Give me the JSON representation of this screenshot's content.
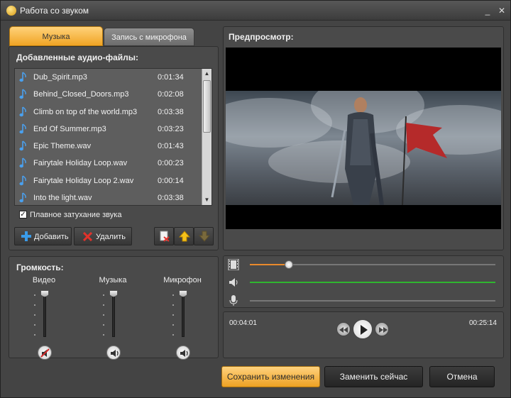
{
  "window": {
    "title": "Работа со звуком",
    "minimize_glyph": "_",
    "close_glyph": "✕"
  },
  "tabs": [
    {
      "label": "Музыка",
      "active": true
    },
    {
      "label": "Запись с микрофона",
      "active": false
    }
  ],
  "audio_section": {
    "title": "Добавленные аудио-файлы:",
    "files": [
      {
        "name": "Dub_Spirit.mp3",
        "duration": "0:01:34"
      },
      {
        "name": "Behind_Closed_Doors.mp3",
        "duration": "0:02:08"
      },
      {
        "name": "Climb on top of the world.mp3",
        "duration": "0:03:38"
      },
      {
        "name": "End Of Summer.mp3",
        "duration": "0:03:23"
      },
      {
        "name": "Epic Theme.wav",
        "duration": "0:01:43"
      },
      {
        "name": "Fairytale Holiday Loop.wav",
        "duration": "0:00:23"
      },
      {
        "name": "Fairytale Holiday Loop 2.wav",
        "duration": "0:00:14"
      },
      {
        "name": "Into the light.wav",
        "duration": "0:03:38"
      }
    ],
    "fade_label": "Плавное затухание звука",
    "fade_checked": true,
    "add_label": "Добавить",
    "delete_label": "Удалить"
  },
  "volume_section": {
    "title": "Громкость:",
    "channels": [
      {
        "label": "Видео",
        "level": 0.8,
        "muted": true
      },
      {
        "label": "Музыка",
        "level": 0.8,
        "muted": false
      },
      {
        "label": "Микрофон",
        "level": 0.8,
        "muted": false
      }
    ]
  },
  "preview_section": {
    "title": "Предпросмотр:",
    "time_current": "00:04:01",
    "time_total": "00:25:14",
    "video_progress": 0.16
  },
  "footer": {
    "save_label": "Сохранить изменения",
    "replace_label": "Заменить сейчас",
    "cancel_label": "Отмена"
  },
  "colors": {
    "accent_orange": "#f0a424",
    "music_track": "#2fb52f",
    "video_progress": "#e98a2c"
  }
}
